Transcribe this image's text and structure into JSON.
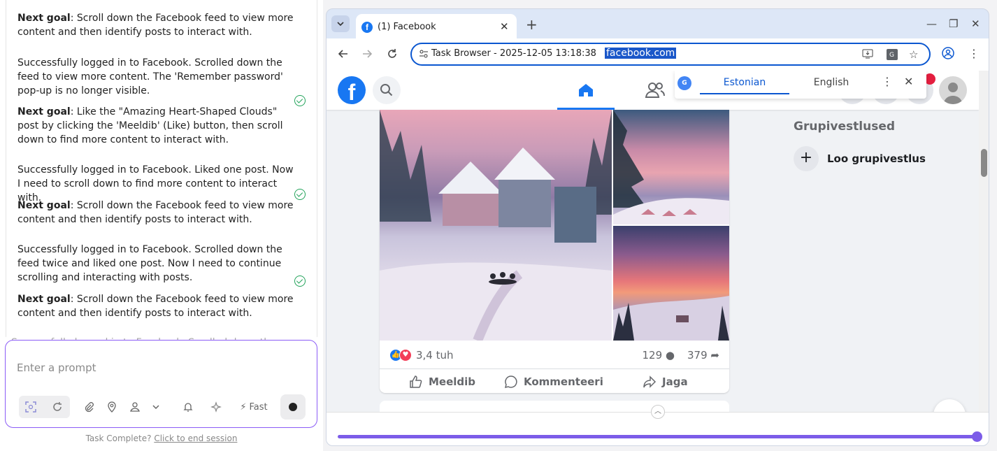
{
  "agent_panel": {
    "messages": [
      {
        "next_goal_label": "Next goal",
        "next_goal": ": Scroll down the Facebook feed to view more content and then identify posts to interact with."
      },
      {
        "status": "Successfully logged in to Facebook. Scrolled down the feed to view more content. The 'Remember password' pop-up is no longer visible.",
        "next_goal_label": "Next goal",
        "next_goal": ": Like the \"Amazing Heart-Shaped Clouds\" post by clicking the 'Meeldib' (Like) button, then scroll down to find more content to interact with."
      },
      {
        "status": "Successfully logged in to Facebook. Liked one post. Now I need to scroll down to find more content to interact with.",
        "next_goal_label": "Next goal",
        "next_goal": ": Scroll down the Facebook feed to view more content and then identify posts to interact with."
      },
      {
        "status": "Successfully logged in to Facebook. Scrolled down the feed twice and liked one post. Now I need to continue scrolling and interacting with posts.",
        "next_goal_label": "Next goal",
        "next_goal": ": Scroll down the Facebook feed to view more content and then identify posts to interact with."
      }
    ],
    "faded_text": "Successfully logged in to Facebook. Scrolled down the feed",
    "prompt_placeholder": "Enter a prompt",
    "fast_label": "Fast",
    "task_complete_text": "Task Complete?",
    "end_session_link": "Click to end session"
  },
  "browser": {
    "tab_title": "(1) Facebook",
    "tab_favicon": "f",
    "omnibox_text": "Task Browser - 2025-12-05 13:18:38",
    "omnibox_url": "facebook.com"
  },
  "translate": {
    "badge": "G",
    "lang_from": "Estonian",
    "lang_to": "English"
  },
  "facebook": {
    "logo": "f",
    "post": {
      "reactions_count": "3,4 tuh",
      "comments_count": "129",
      "shares_count": "379",
      "like_label": "Meeldib",
      "comment_label": "Kommenteeri",
      "share_label": "Jaga"
    },
    "right_column": {
      "title": "Grupivestlused",
      "create_group_label": "Loo grupivestlus"
    }
  },
  "progress": 1.0,
  "colors": {
    "accent": "#7c5ce8",
    "facebook_blue": "#1877f2",
    "chrome_blue": "#0b57d0",
    "success_green": "#22a35a"
  }
}
